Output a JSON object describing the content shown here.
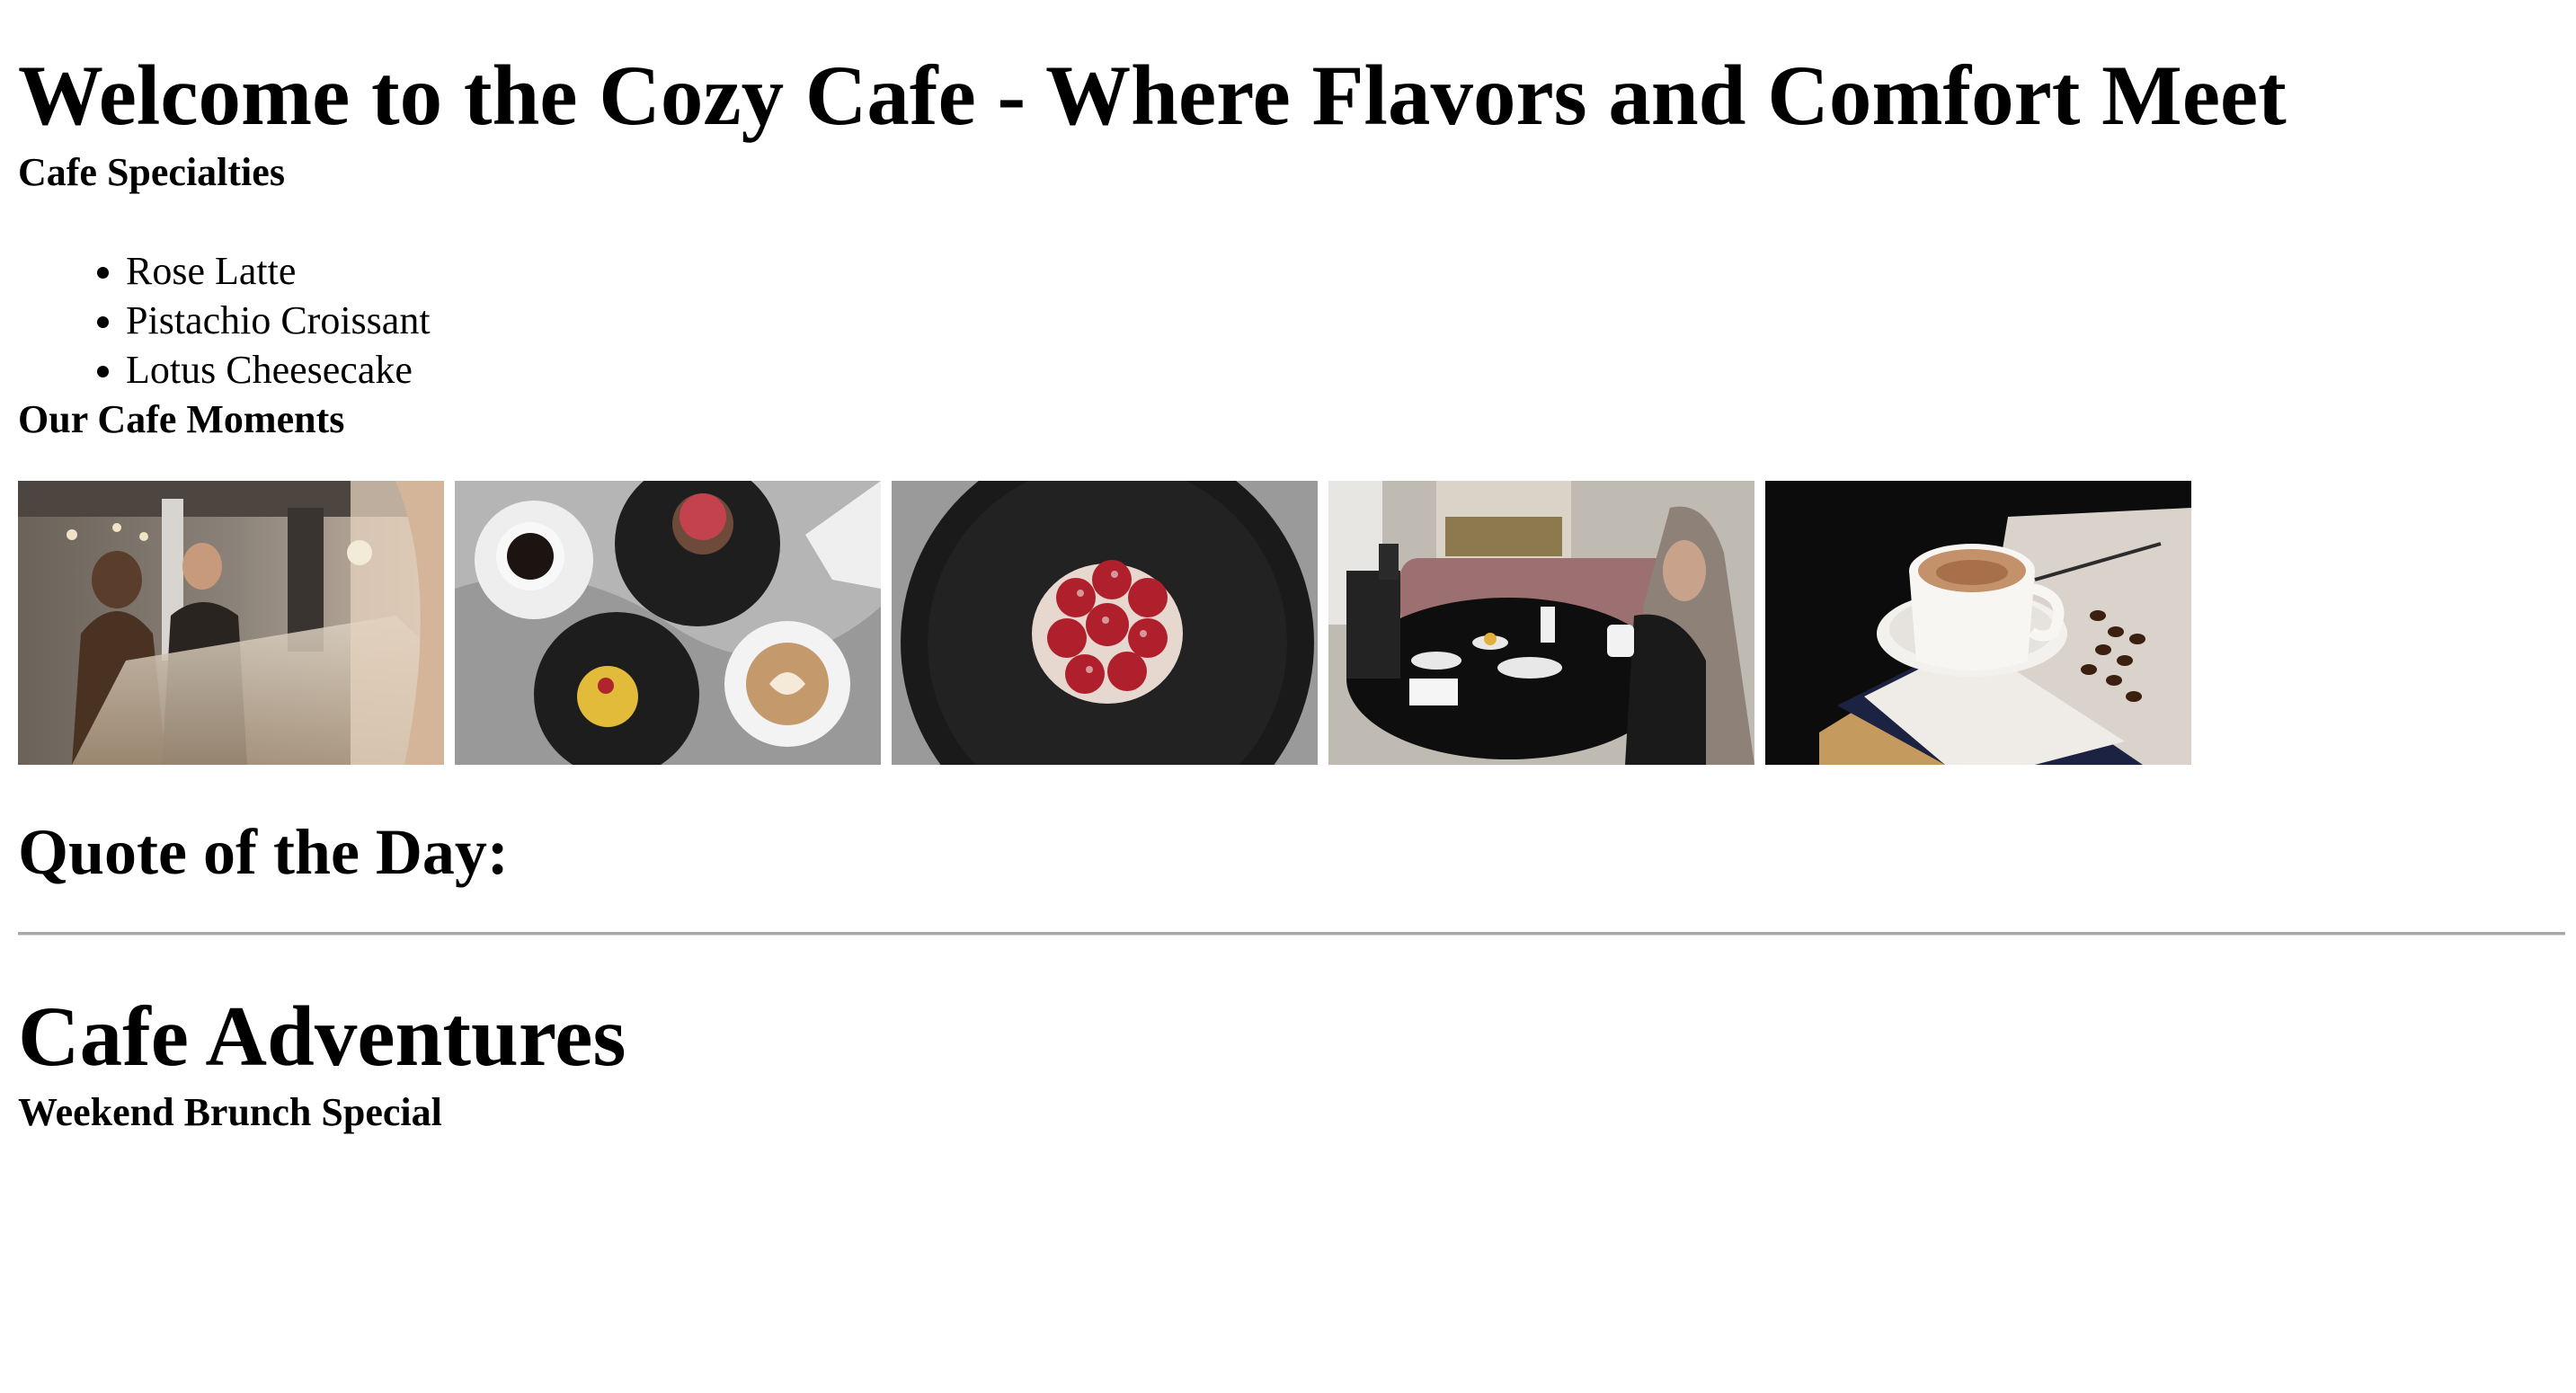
{
  "header": {
    "title": "Welcome to the Cozy Cafe - Where Flavors and Comfort Meet"
  },
  "specialties": {
    "heading": "Cafe Specialties",
    "items": [
      {
        "label": "Rose Latte"
      },
      {
        "label": "Pistachio Croissant"
      },
      {
        "label": "Lotus Cheesecake"
      }
    ]
  },
  "moments": {
    "heading": "Our Cafe Moments",
    "photos": [
      {
        "name": "couple-at-pastry-counter-photo"
      },
      {
        "name": "coffee-and-desserts-flatlay-photo"
      },
      {
        "name": "raspberry-tart-photo"
      },
      {
        "name": "women-at-cafe-table-photo"
      },
      {
        "name": "cappuccino-with-beans-photo"
      }
    ]
  },
  "quote": {
    "heading": "Quote of the Day:"
  },
  "adventures": {
    "title": "Cafe Adventures",
    "subheading": "Weekend Brunch Special"
  }
}
